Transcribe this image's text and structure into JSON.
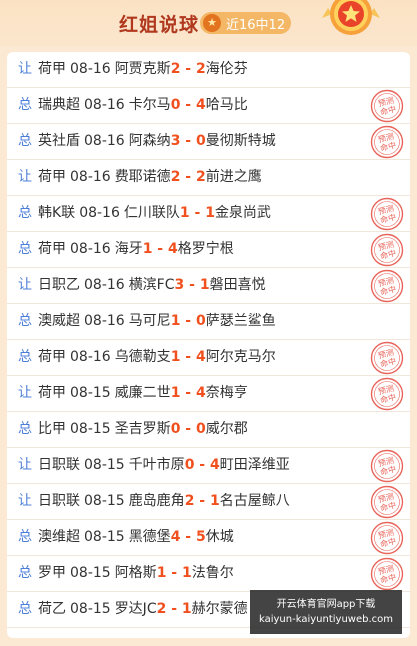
{
  "header": {
    "title": "红姐说球",
    "badge": "近16中12",
    "badge_icon": "star-icon",
    "medal_icon": "medal-icon"
  },
  "colors": {
    "tag": "#4d7fd8",
    "score": "#f0501e",
    "title": "#b0381e",
    "stamp": "#e8655a"
  },
  "stamp_label": "预测命中",
  "matches": [
    {
      "tag": "让",
      "league": "荷甲",
      "date": "08-16",
      "home": "阿贾克斯",
      "home_score": "2",
      "away_score": "2",
      "away": "海伦芬",
      "hit": false
    },
    {
      "tag": "总",
      "league": "瑞典超",
      "date": "08-16",
      "home": "卡尔马",
      "home_score": "0",
      "away_score": "4",
      "away": "哈马比",
      "hit": true
    },
    {
      "tag": "总",
      "league": "英社盾",
      "date": "08-16",
      "home": "阿森纳",
      "home_score": "3",
      "away_score": "0",
      "away": "曼彻斯特城",
      "hit": true
    },
    {
      "tag": "让",
      "league": "荷甲",
      "date": "08-16",
      "home": "费耶诺德",
      "home_score": "2",
      "away_score": "2",
      "away": "前进之鹰",
      "hit": false
    },
    {
      "tag": "总",
      "league": "韩K联",
      "date": "08-16",
      "home": "仁川联队",
      "home_score": "1",
      "away_score": "1",
      "away": "金泉尚武",
      "hit": true
    },
    {
      "tag": "总",
      "league": "荷甲",
      "date": "08-16",
      "home": "海牙",
      "home_score": "1",
      "away_score": "4",
      "away": "格罗宁根",
      "hit": true
    },
    {
      "tag": "让",
      "league": "日职乙",
      "date": "08-16",
      "home": "横滨FC",
      "home_score": "3",
      "away_score": "1",
      "away": "磐田喜悦",
      "hit": true
    },
    {
      "tag": "总",
      "league": "澳威超",
      "date": "08-16",
      "home": "马可尼",
      "home_score": "1",
      "away_score": "0",
      "away": "萨瑟兰鲨鱼",
      "hit": false
    },
    {
      "tag": "总",
      "league": "荷甲",
      "date": "08-16",
      "home": "乌德勒支",
      "home_score": "1",
      "away_score": "4",
      "away": "阿尔克马尔",
      "hit": true
    },
    {
      "tag": "让",
      "league": "荷甲",
      "date": "08-15",
      "home": "威廉二世",
      "home_score": "1",
      "away_score": "4",
      "away": "奈梅亨",
      "hit": true
    },
    {
      "tag": "总",
      "league": "比甲",
      "date": "08-15",
      "home": "圣吉罗斯",
      "home_score": "0",
      "away_score": "0",
      "away": "威尔郡",
      "hit": false
    },
    {
      "tag": "让",
      "league": "日职联",
      "date": "08-15",
      "home": "千叶市原",
      "home_score": "0",
      "away_score": "4",
      "away": "町田泽维亚",
      "hit": true
    },
    {
      "tag": "让",
      "league": "日职联",
      "date": "08-15",
      "home": "鹿岛鹿角",
      "home_score": "2",
      "away_score": "1",
      "away": "名古屋鲸八",
      "hit": true
    },
    {
      "tag": "总",
      "league": "澳维超",
      "date": "08-15",
      "home": "黑德堡",
      "home_score": "4",
      "away_score": "5",
      "away": "休城",
      "hit": true
    },
    {
      "tag": "总",
      "league": "罗甲",
      "date": "08-15",
      "home": "阿格斯",
      "home_score": "1",
      "away_score": "1",
      "away": "法鲁尔",
      "hit": true
    },
    {
      "tag": "总",
      "league": "荷乙",
      "date": "08-15",
      "home": "罗达JC",
      "home_score": "2",
      "away_score": "1",
      "away": "赫尔蒙德",
      "hit": false
    }
  ],
  "watermark": {
    "line1": "开云体育官网app下载",
    "line2": "kaiyun-kaiyuntiyuweb.com"
  }
}
